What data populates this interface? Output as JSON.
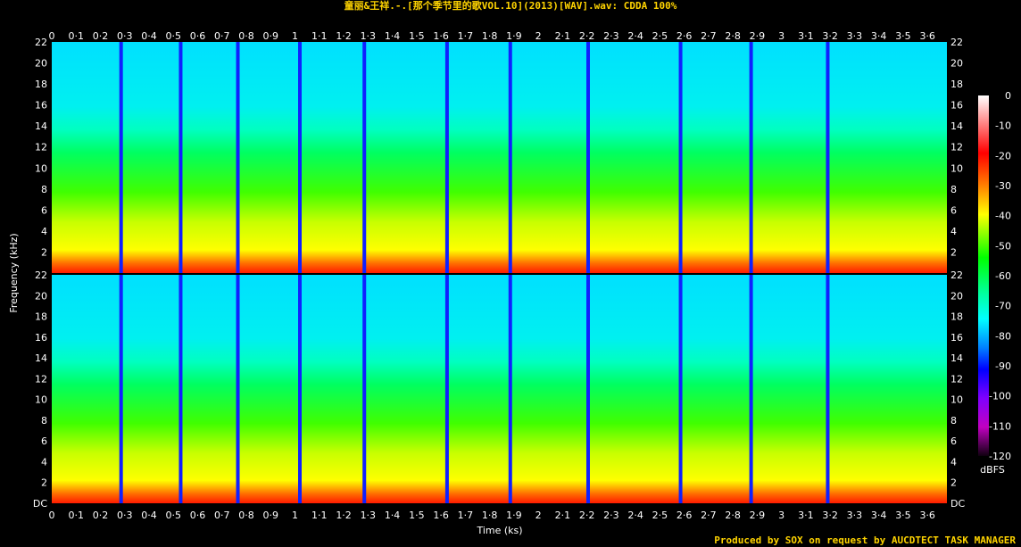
{
  "title": "童丽&王祥.-.[那个季节里的歌VOL.10](2013)[WAV].wav: CDDA 100%",
  "footer": "Produced by SOX on request by AUCDTECT TASK MANAGER",
  "chart_data": {
    "type": "heatmap",
    "xlabel": "Time (ks)",
    "ylabel": "Frequency (kHz)",
    "colorbar_label": "dBFS",
    "x_range": [
      0,
      3.68
    ],
    "y_range": [
      0,
      22
    ],
    "color_range": [
      -120,
      0
    ],
    "x_ticks": [
      "0",
      "0·1",
      "0·2",
      "0·3",
      "0·4",
      "0·5",
      "0·6",
      "0·7",
      "0·8",
      "0·9",
      "1",
      "1·1",
      "1·2",
      "1·3",
      "1·4",
      "1·5",
      "1·6",
      "1·7",
      "1·8",
      "1·9",
      "2",
      "2·1",
      "2·2",
      "2·3",
      "2·4",
      "2·5",
      "2·6",
      "2·7",
      "2·8",
      "2·9",
      "3",
      "3·1",
      "3·2",
      "3·3",
      "3·4",
      "3·5",
      "3·6"
    ],
    "y_ticks_top": [
      "2",
      "4",
      "6",
      "8",
      "10",
      "12",
      "14",
      "16",
      "18",
      "20",
      "22"
    ],
    "y_ticks_bottom": [
      "DC",
      "2",
      "4",
      "6",
      "8",
      "10",
      "12",
      "14",
      "16",
      "18",
      "20",
      "22"
    ],
    "colorbar_ticks": [
      "0",
      "-10",
      "-20",
      "-30",
      "-40",
      "-50",
      "-60",
      "-70",
      "-80",
      "-90",
      "-100",
      "-110",
      "-120"
    ],
    "channels": [
      "left",
      "right"
    ],
    "track_boundaries_ks": [
      0.285,
      0.53,
      0.765,
      1.02,
      1.285,
      1.625,
      1.885,
      2.205,
      2.585,
      2.875,
      3.19
    ],
    "grid": false
  }
}
